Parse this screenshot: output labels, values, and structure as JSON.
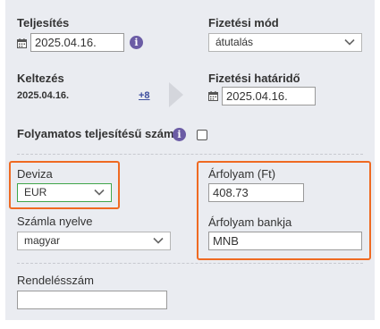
{
  "teljesites": {
    "label": "Teljesítés",
    "date": "2025.04.16."
  },
  "fizetesi_mod": {
    "label": "Fizetési mód",
    "value": "átutalás"
  },
  "keltezes": {
    "label": "Keltezés",
    "value": "2025.04.16.",
    "link": "+8"
  },
  "fizetesi_hatarido": {
    "label": "Fizetési határidő",
    "date": "2025.04.16."
  },
  "folyamatos": {
    "label": "Folyamatos teljesítésű számla",
    "checked": false
  },
  "deviza": {
    "label": "Deviza",
    "value": "EUR"
  },
  "arfolyam": {
    "label": "Árfolyam (Ft)",
    "value": "408.73"
  },
  "szamla_nyelve": {
    "label": "Számla nyelve",
    "value": "magyar"
  },
  "arfolyam_bankja": {
    "label": "Árfolyam bankja",
    "value": "MNB"
  },
  "rendelesszam": {
    "label": "Rendelésszám",
    "value": ""
  },
  "icons": {
    "info": "i"
  },
  "colors": {
    "highlight": "#ef6a22",
    "info_badge": "#6b5ca5",
    "deviza_border": "#3fa64a",
    "link": "#3d4e9e"
  }
}
